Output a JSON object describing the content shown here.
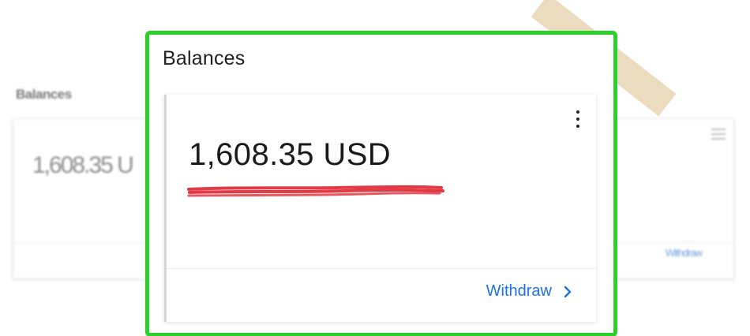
{
  "background_widget": {
    "title": "Balances",
    "amount": "1,608.35 U",
    "link_label": "Withdraw"
  },
  "panel": {
    "title": "Balances",
    "balance": "1,608.35 USD",
    "withdraw_label": "Withdraw",
    "menu_icon": "more-vert-icon",
    "chevron_icon": "chevron-right-icon"
  },
  "colors": {
    "highlight_border": "#2bd12b",
    "underline_marker": "#e23a45",
    "link": "#1a73e8",
    "tape": "#e8d6b4"
  }
}
